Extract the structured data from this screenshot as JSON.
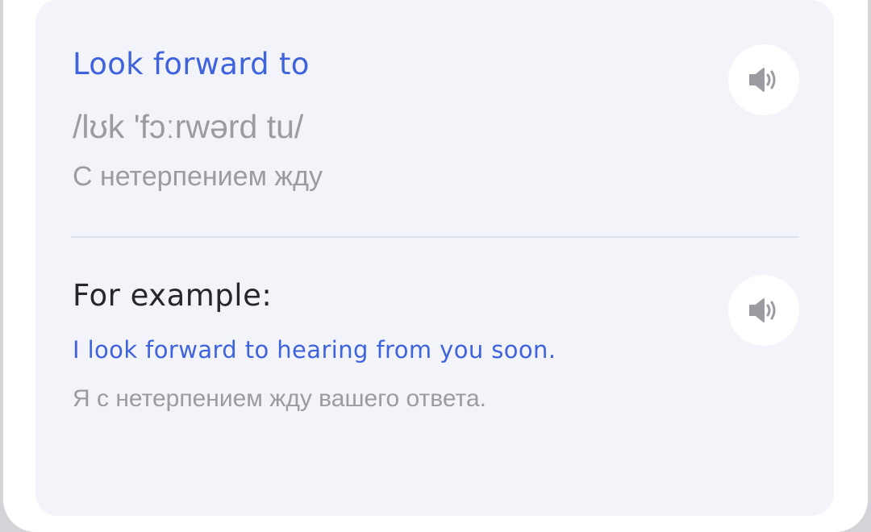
{
  "word_card": {
    "word": "Look forward to",
    "transcription": "/lʊk 'fɔːrwərd tu/",
    "translation": "С нетерпением жду",
    "word_speaker_icon": "speaker-icon"
  },
  "example": {
    "title": "For example:",
    "sentence": "I look forward to hearing from you soon.",
    "translation": "Я с нетерпением жду вашего ответа.",
    "speaker_icon": "speaker-icon"
  },
  "colors": {
    "accent": "#3f63dc",
    "muted_text": "#9a9ca1",
    "card_background": "#f3f4f9",
    "icon": "#9a9ca1"
  }
}
